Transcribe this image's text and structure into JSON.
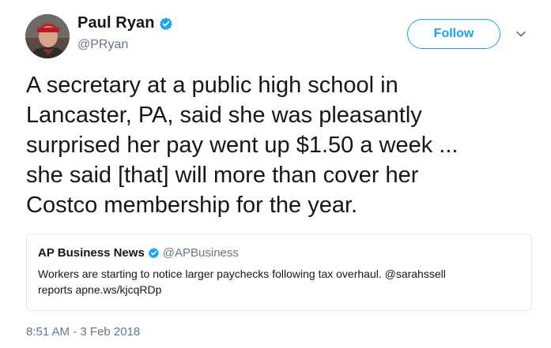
{
  "author": {
    "display_name": "Paul Ryan",
    "handle": "@PRyan",
    "verified": true,
    "avatar_icon": "avatar-photo"
  },
  "follow_button": {
    "label": "Follow"
  },
  "caret": {
    "icon": "chevron-down-icon"
  },
  "tweet": {
    "lines": [
      "A secretary at a public high school in",
      "Lancaster, PA, said she was pleasantly",
      "surprised her pay went up $1.50 a week ...",
      "she said [that] will more than cover her",
      "Costco membership for the year."
    ]
  },
  "quoted_tweet": {
    "display_name": "AP Business News",
    "handle": "@APBusiness",
    "verified": true,
    "lines": [
      "Workers are starting to notice larger paychecks following tax overhaul. @sarahssell",
      "reports apne.ws/kjcqRDp"
    ]
  },
  "timestamp": "8:51 AM - 3 Feb 2018",
  "colors": {
    "accent": "#1da1f2",
    "text": "#14171a",
    "muted": "#657786",
    "border": "#e1e8ed"
  }
}
